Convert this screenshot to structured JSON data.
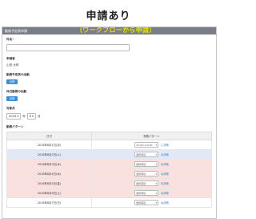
{
  "top_title": "申請あり",
  "overlay_subtitle": "（ワークフローから申請）",
  "panel": {
    "header_title": "勤務予定表申請"
  },
  "form": {
    "name_label": "件名",
    "required_mark": "*",
    "name_value": "",
    "applicant_label": "申請者",
    "applicant_value": "山田 太郎",
    "flag1_label": "勤務予定表の出勤",
    "flag1_value": "出勤",
    "flag2_label": "休日勤務の出勤",
    "flag2_value": "出勤",
    "period_label": "対象月",
    "year_value": "2016",
    "year_unit": "年",
    "month_value": "8",
    "month_unit": "月",
    "pattern_label": "勤務パターン"
  },
  "table": {
    "headers": [
      "日付",
      "勤務パターン"
    ],
    "rows": [
      {
        "date": "2016年8月1日(月)",
        "pattern": "10:00〜19:00",
        "detail": "に詳細",
        "kind": "weekday"
      },
      {
        "date": "2016年8月2日(火)",
        "pattern": "選択項目",
        "detail": "ぬ詳細",
        "kind": "sat"
      },
      {
        "date": "2016年8月3日(水)",
        "pattern": "選択項目",
        "detail": "ぬ詳細",
        "kind": "sun"
      },
      {
        "date": "2016年8月4日(木)",
        "pattern": "選択項目",
        "detail": "ぬ詳細",
        "kind": "sun"
      },
      {
        "date": "2016年8月5日(金)",
        "pattern": "選択項目",
        "detail": "ぬ詳細",
        "kind": "sun"
      },
      {
        "date": "2016年8月6日(土)",
        "pattern": "選択項目",
        "detail": "ぬ詳細",
        "kind": "sun"
      },
      {
        "date": "2016年8月7日(日)",
        "pattern": "選択項目",
        "detail": "ぬ詳細",
        "kind": "weekday"
      }
    ]
  },
  "colors": {
    "header_bar": "#7a7f87",
    "accent": "#3b8ed4",
    "overlay_text": "#f0e000",
    "sun_row": "#fbe0e0",
    "sat_row": "#e3e8f7"
  }
}
